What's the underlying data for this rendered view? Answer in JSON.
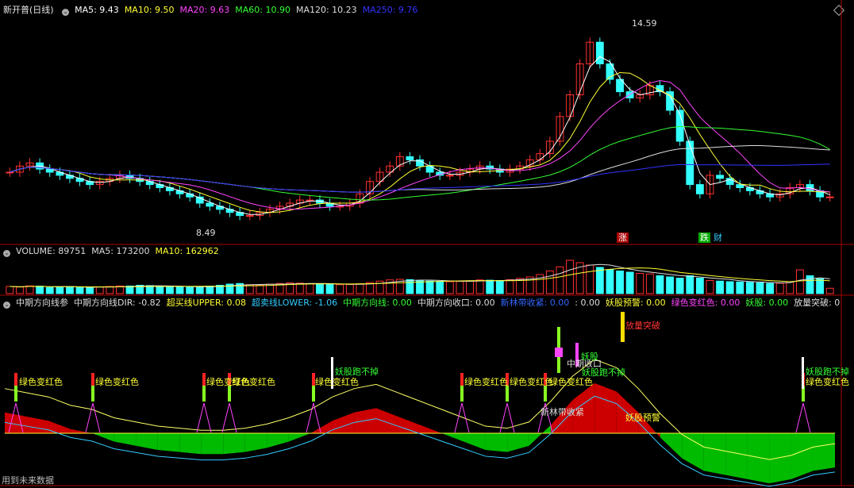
{
  "header": {
    "title": "新开普(日线)",
    "items": [
      {
        "label": "MA5: 9.43",
        "color": "#ffffff"
      },
      {
        "label": "MA10: 9.50",
        "color": "#ffff33"
      },
      {
        "label": "MA20: 9.63",
        "color": "#ff44ff"
      },
      {
        "label": "MA60: 10.90",
        "color": "#33ff33"
      },
      {
        "label": "MA120: 10.23",
        "color": "#dddddd"
      },
      {
        "label": "MA250: 9.76",
        "color": "#3333ff"
      }
    ]
  },
  "price_chart": {
    "high_label": "14.59",
    "low_label": "8.49",
    "tag_up": "涨",
    "tag_down": "跌",
    "tag_fin": "财"
  },
  "volume_header": {
    "items": [
      {
        "label": "VOLUME: 89751",
        "color": "#dddddd"
      },
      {
        "label": "MA5: 173200",
        "color": "#dddddd"
      },
      {
        "label": "MA10: 162962",
        "color": "#ffff33"
      }
    ]
  },
  "indicator_header": {
    "name": "中期方向线参",
    "items": [
      {
        "label": "中期方向线DIR: -0.82",
        "color": "#dddddd"
      },
      {
        "label": "超买线UPPER: 0.08",
        "color": "#ffff33"
      },
      {
        "label": "超卖线LOWER: -1.06",
        "color": "#33ccff"
      },
      {
        "label": "中期方向线: 0.00",
        "color": "#33ff33"
      },
      {
        "label": "中期方向收口: 0.00",
        "color": "#dddddd"
      },
      {
        "label": "新林带收紧: 0.00",
        "color": "#3366ff"
      },
      {
        "label": ": 0.00",
        "color": "#dddddd"
      },
      {
        "label": "妖股预警: 0.00",
        "color": "#ffff33"
      },
      {
        "label": "绿色变红色: 0.00",
        "color": "#ff44ff"
      },
      {
        "label": "妖股: 0.00",
        "color": "#33ff33"
      },
      {
        "label": "放量突破: 0",
        "color": "#dddddd"
      }
    ]
  },
  "signals": {
    "green_to_red": "绿色变红色",
    "yao_gu_pao_bu_diao": "妖股跑不掉",
    "yao_gu": "妖股",
    "yao_gu_yu_jing": "妖股预警",
    "fang_liang_tu_po": "放量突破",
    "zhong_qi_shou_kou": "中期收口",
    "xin_lin_dai_shou_jin": "新林带收紧"
  },
  "footer": {
    "label": "用到未来数据"
  },
  "chart_data": [
    {
      "type": "candlestick",
      "title": "新开普(日线)",
      "ylim": [
        8.0,
        15.0
      ],
      "annotations": [
        {
          "label": "14.59",
          "value": 14.59
        },
        {
          "label": "8.49",
          "value": 8.49
        }
      ],
      "series": [
        {
          "name": "close",
          "values": [
            10.0,
            10.2,
            10.3,
            10.1,
            10.0,
            9.9,
            9.8,
            9.7,
            9.6,
            9.7,
            9.8,
            9.9,
            9.8,
            9.7,
            9.6,
            9.5,
            9.4,
            9.3,
            9.2,
            9.0,
            8.9,
            8.8,
            8.7,
            8.6,
            8.6,
            8.7,
            8.8,
            8.9,
            9.0,
            9.1,
            9.1,
            9.0,
            8.9,
            8.9,
            9.0,
            9.3,
            9.7,
            10.0,
            10.2,
            10.5,
            10.4,
            10.2,
            10.0,
            9.9,
            9.9,
            10.0,
            10.1,
            10.2,
            10.1,
            10.0,
            10.1,
            10.2,
            10.4,
            10.6,
            11.0,
            11.8,
            12.5,
            13.5,
            14.2,
            13.5,
            13.0,
            12.6,
            12.4,
            12.5,
            12.8,
            12.6,
            12.0,
            11.0,
            9.6,
            9.3,
            9.9,
            9.8,
            9.6,
            9.5,
            9.4,
            9.3,
            9.2,
            9.3,
            9.5,
            9.6,
            9.4,
            9.2,
            9.2
          ]
        }
      ]
    },
    {
      "type": "bar",
      "title": "VOLUME",
      "series": [
        {
          "name": "VOLUME",
          "values": [
            120000,
            110000,
            130000,
            125000,
            100000,
            115000,
            118000,
            105000,
            98000,
            112000,
            120000,
            130000,
            128000,
            140000,
            135000,
            122000,
            118000,
            110000,
            108000,
            115000,
            125000,
            140000,
            160000,
            170000,
            150000,
            145000,
            160000,
            170000,
            180000,
            176000,
            168000,
            160000,
            155000,
            150000,
            152000,
            165000,
            185000,
            210000,
            230000,
            240000,
            235000,
            220000,
            210000,
            205000,
            200000,
            205000,
            215000,
            230000,
            225000,
            220000,
            235000,
            255000,
            280000,
            320000,
            380000,
            450000,
            560000,
            520000,
            480000,
            440000,
            400000,
            380000,
            360000,
            340000,
            330000,
            300000,
            280000,
            260000,
            300000,
            260000,
            220000,
            210000,
            200000,
            195000,
            190000,
            180000,
            170000,
            175000,
            200000,
            400000,
            300000,
            250000,
            89751
          ]
        }
      ]
    },
    {
      "type": "area",
      "title": "中期方向线",
      "series": [
        {
          "name": "DIR",
          "values": [
            0.5,
            0.4,
            0.3,
            0.1,
            0.0,
            -0.2,
            -0.3,
            -0.4,
            -0.45,
            -0.5,
            -0.5,
            -0.45,
            -0.35,
            -0.2,
            0.0,
            0.3,
            0.5,
            0.6,
            0.4,
            0.2,
            0.0,
            -0.2,
            -0.4,
            -0.45,
            -0.3,
            0.2,
            0.8,
            1.2,
            1.0,
            0.5,
            -0.1,
            -0.6,
            -0.9,
            -1.0,
            -1.1,
            -1.2,
            -1.1,
            -0.9,
            -0.82
          ]
        }
      ]
    }
  ]
}
